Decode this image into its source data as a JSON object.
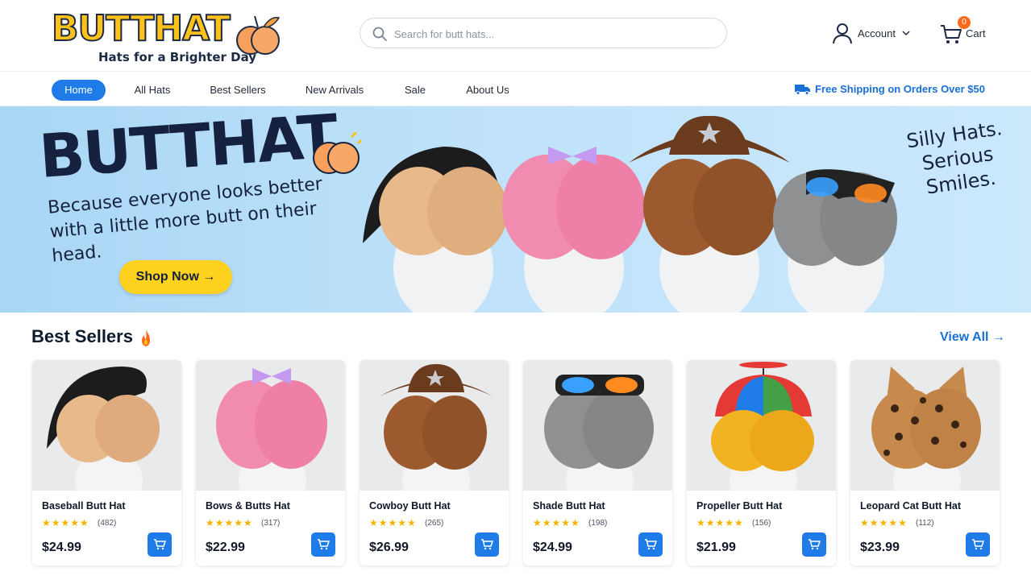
{
  "brand": {
    "logo_text": "BUTTHAT",
    "tagline": "Hats for a Brighter Day"
  },
  "search": {
    "placeholder": "Search for butt hats..."
  },
  "account": {
    "label": "Account"
  },
  "cart": {
    "label": "Cart",
    "count": "0"
  },
  "nav": {
    "items": [
      {
        "label": "Home",
        "active": true
      },
      {
        "label": "All Hats"
      },
      {
        "label": "Best Sellers"
      },
      {
        "label": "New Arrivals"
      },
      {
        "label": "Sale"
      },
      {
        "label": "About Us"
      }
    ],
    "shipping": "Free Shipping on Orders Over $50"
  },
  "hero": {
    "title": "BUTTHAT",
    "subtitle": "Because everyone looks better with a little more butt on their head.",
    "cta": "Shop Now →",
    "tagline": "Silly Hats. Serious Smiles."
  },
  "best_sellers": {
    "title": "Best Sellers",
    "view_all": "View All →",
    "products": [
      {
        "name": "Baseball Butt Hat",
        "rating": "★★★★★",
        "reviews": "(482)",
        "price": "$24.99",
        "color": "#e8b98a",
        "hat": "cap"
      },
      {
        "name": "Bows & Butts Hat",
        "rating": "★★★★★",
        "reviews": "(317)",
        "price": "$22.99",
        "color": "#f28bb0",
        "hat": "bow"
      },
      {
        "name": "Cowboy Butt Hat",
        "rating": "★★★★★",
        "reviews": "(265)",
        "price": "$26.99",
        "color": "#9c5a2e",
        "hat": "cowboy"
      },
      {
        "name": "Shade Butt Hat",
        "rating": "★★★★★",
        "reviews": "(198)",
        "price": "$24.99",
        "color": "#8f9092",
        "hat": "shades"
      },
      {
        "name": "Propeller Butt Hat",
        "rating": "★★★★★",
        "reviews": "(156)",
        "price": "$21.99",
        "color": "#f2b322",
        "hat": "propeller"
      },
      {
        "name": "Leopard Cat Butt Hat",
        "rating": "★★★★★",
        "reviews": "(112)",
        "price": "$23.99",
        "color": "#c88a4c",
        "hat": "cat"
      }
    ]
  },
  "colors": {
    "accent": "#1e7be8",
    "cta": "#ffd21f",
    "badge": "#ff6b1a",
    "hero_bg": "#bfe2fa"
  }
}
